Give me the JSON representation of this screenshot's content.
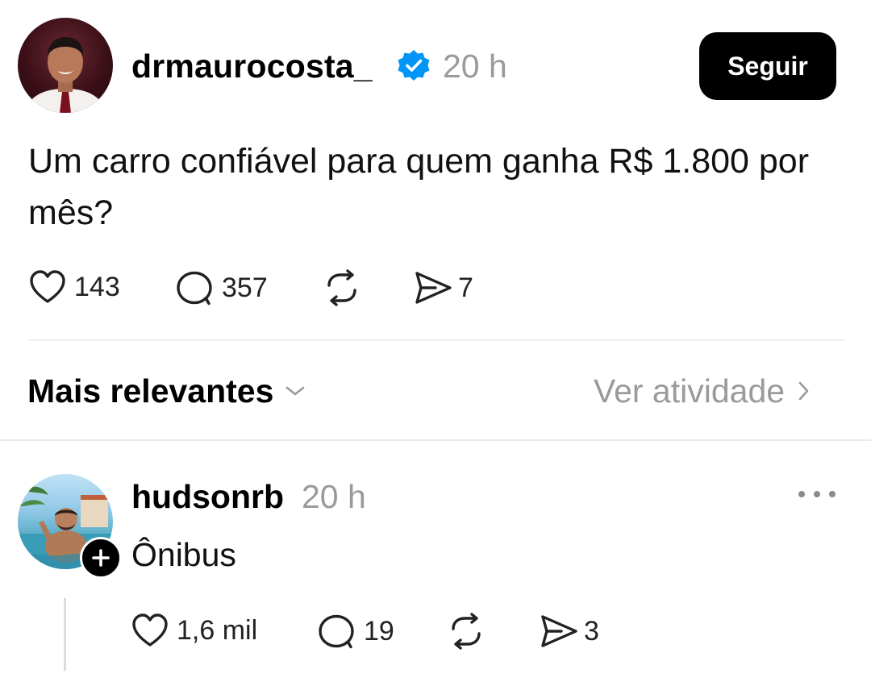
{
  "post": {
    "username": "drmaurocosta_",
    "verified": true,
    "time": "20 h",
    "follow_label": "Seguir",
    "text": "Um carro confiável para quem ganha R$ 1.800 por mês?",
    "likes": "143",
    "comments": "357",
    "shares": "7",
    "icons": [
      "heart-icon",
      "comment-icon",
      "repost-icon",
      "share-icon"
    ]
  },
  "sort": {
    "label": "Mais relevantes",
    "activity_label": "Ver atividade"
  },
  "reply": {
    "username": "hudsonrb",
    "time": "20 h",
    "text": "Ônibus",
    "likes": "1,6 mil",
    "comments": "19",
    "shares": "3",
    "icons": [
      "heart-icon",
      "comment-icon",
      "repost-icon",
      "share-icon",
      "more-icon",
      "plus-icon"
    ]
  },
  "colors": {
    "text_primary": "#000000",
    "text_secondary": "#9a9a9a",
    "verified_blue": "#0095f6",
    "button_bg": "#000000",
    "button_text": "#ffffff"
  }
}
